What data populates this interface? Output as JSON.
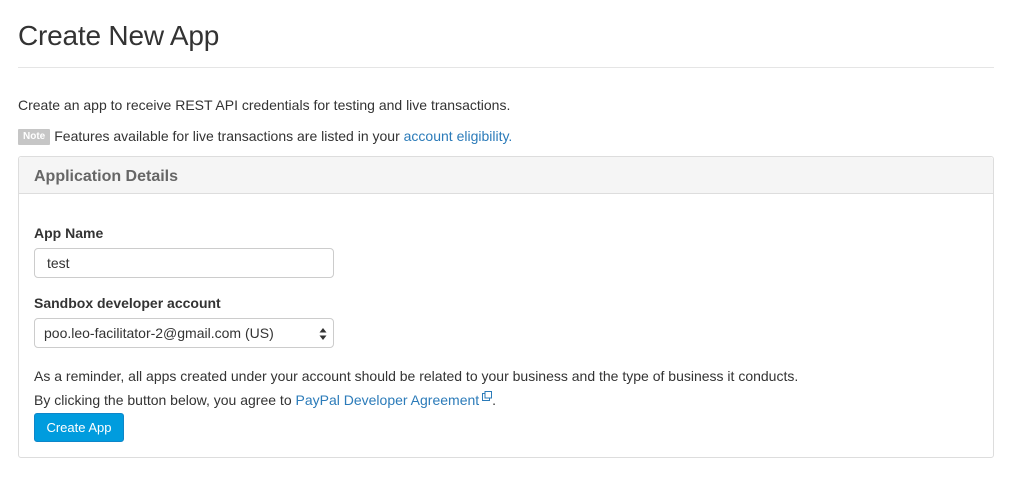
{
  "header": {
    "title": "Create New App"
  },
  "intro_text": "Create an app to receive REST API credentials for testing and live transactions.",
  "note": {
    "badge": "Note",
    "text": "Features available for live transactions are listed in your ",
    "link_text": "account eligibility."
  },
  "panel": {
    "title": "Application Details",
    "app_name": {
      "label": "App Name",
      "value": "test"
    },
    "sandbox_account": {
      "label": "Sandbox developer account",
      "selected": "poo.leo-facilitator-2@gmail.com (US)"
    },
    "reminder_line1": "As a reminder, all apps created under your account should be related to your business and the type of business it conducts.",
    "agree_prefix": "By clicking the button below, you agree to ",
    "agreement_link": "PayPal Developer Agreement",
    "agree_suffix": ".",
    "create_button": "Create App"
  },
  "colors": {
    "link": "#2b7bb9",
    "button": "#009cde",
    "note_badge": "#c6c6c6"
  },
  "icons": {
    "external_link": "external-link-icon",
    "select_arrows": "select-arrows-icon"
  }
}
